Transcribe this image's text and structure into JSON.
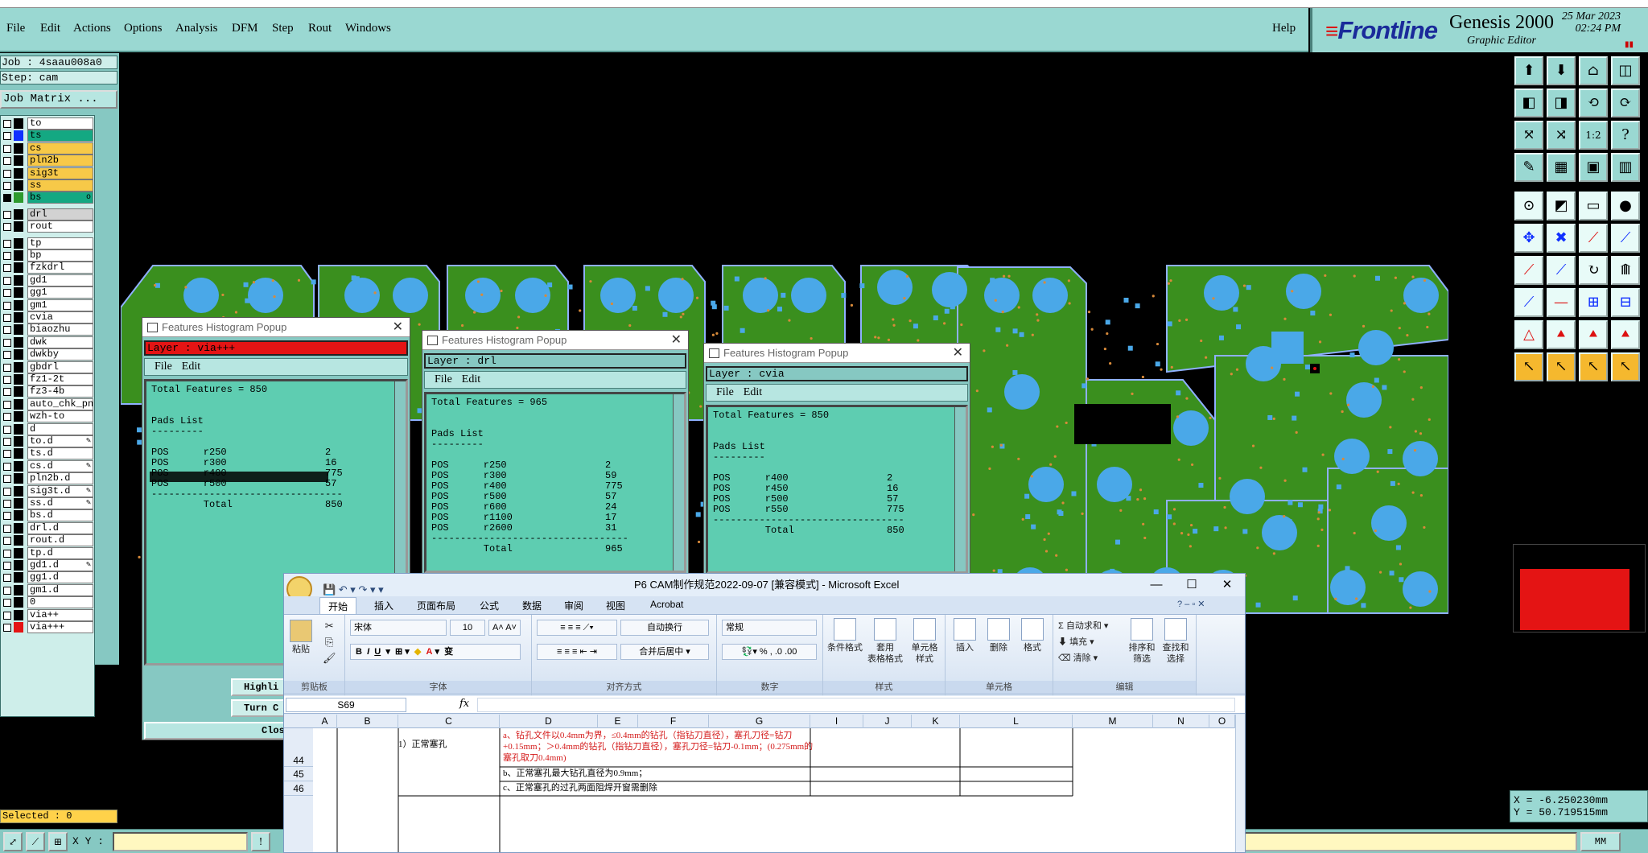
{
  "menu": {
    "items": [
      "File",
      "Edit",
      "Actions",
      "Options",
      "Analysis",
      "DFM",
      "Step",
      "Rout",
      "Windows"
    ],
    "help": "Help"
  },
  "brand": {
    "logo": "Frontline",
    "title": "Genesis 2000",
    "subtitle": "Graphic Editor",
    "date": "25 Mar 2023",
    "time": "02:24 PM"
  },
  "left": {
    "job": "Job : 4saau008a0",
    "step": "Step: cam",
    "job_matrix": "Job Matrix ...",
    "layers": [
      {
        "name": "to",
        "color": "#000000",
        "bg": "#ffffff",
        "checked": false
      },
      {
        "name": "ts",
        "color": "#1030ff",
        "bg": "#14a882",
        "checked": false
      },
      {
        "name": "cs",
        "color": "#000000",
        "bg": "#f7c948",
        "checked": false
      },
      {
        "name": "pln2b",
        "color": "#000000",
        "bg": "#f7c948",
        "checked": false
      },
      {
        "name": "sig3t",
        "color": "#000000",
        "bg": "#f7c948",
        "checked": false
      },
      {
        "name": "ss",
        "color": "#000000",
        "bg": "#f7c948",
        "checked": false
      },
      {
        "name": "bs",
        "color": "#2e9a2e",
        "bg": "#14a882",
        "checked": true,
        "mark": "o"
      },
      {
        "name": "drl",
        "color": "#000000",
        "bg": "#d2d2d2",
        "checked": false
      },
      {
        "name": "rout",
        "color": "#000000",
        "bg": "#ffffff",
        "checked": false
      },
      {
        "name": "tp",
        "color": "#000000",
        "bg": "#ffffff",
        "checked": false
      },
      {
        "name": "bp",
        "color": "#000000",
        "bg": "#ffffff",
        "checked": false
      },
      {
        "name": "fzkdrl",
        "color": "#000000",
        "bg": "#ffffff",
        "checked": false
      },
      {
        "name": "gd1",
        "color": "#000000",
        "bg": "#ffffff",
        "checked": false
      },
      {
        "name": "gg1",
        "color": "#000000",
        "bg": "#ffffff",
        "checked": false
      },
      {
        "name": "gm1",
        "color": "#000000",
        "bg": "#ffffff",
        "checked": false
      },
      {
        "name": "cvia",
        "color": "#000000",
        "bg": "#ffffff",
        "checked": false
      },
      {
        "name": "biaozhu",
        "color": "#000000",
        "bg": "#ffffff",
        "checked": false
      },
      {
        "name": "dwk",
        "color": "#000000",
        "bg": "#ffffff",
        "checked": false
      },
      {
        "name": "dwkby",
        "color": "#000000",
        "bg": "#ffffff",
        "checked": false
      },
      {
        "name": "gbdrl",
        "color": "#000000",
        "bg": "#ffffff",
        "checked": false
      },
      {
        "name": "fz1-2t",
        "color": "#000000",
        "bg": "#ffffff",
        "checked": false
      },
      {
        "name": "fz3-4b",
        "color": "#000000",
        "bg": "#ffffff",
        "checked": false
      },
      {
        "name": "auto_chk_pn",
        "color": "#000000",
        "bg": "#ffffff",
        "checked": false
      },
      {
        "name": "wzh-to",
        "color": "#000000",
        "bg": "#ffffff",
        "checked": false
      },
      {
        "name": "d",
        "color": "#000000",
        "bg": "#ffffff",
        "checked": false
      },
      {
        "name": "to.d",
        "color": "#000000",
        "bg": "#ffffff",
        "checked": false,
        "mark": "✎"
      },
      {
        "name": "ts.d",
        "color": "#000000",
        "bg": "#ffffff",
        "checked": false
      },
      {
        "name": "cs.d",
        "color": "#000000",
        "bg": "#ffffff",
        "checked": false,
        "mark": "✎"
      },
      {
        "name": "pln2b.d",
        "color": "#000000",
        "bg": "#ffffff",
        "checked": false
      },
      {
        "name": "sig3t.d",
        "color": "#000000",
        "bg": "#ffffff",
        "checked": false,
        "mark": "✎"
      },
      {
        "name": "ss.d",
        "color": "#000000",
        "bg": "#ffffff",
        "checked": false,
        "mark": "✎"
      },
      {
        "name": "bs.d",
        "color": "#000000",
        "bg": "#ffffff",
        "checked": false
      },
      {
        "name": "drl.d",
        "color": "#000000",
        "bg": "#ffffff",
        "checked": false
      },
      {
        "name": "rout.d",
        "color": "#000000",
        "bg": "#ffffff",
        "checked": false
      },
      {
        "name": "tp.d",
        "color": "#000000",
        "bg": "#ffffff",
        "checked": false
      },
      {
        "name": "gd1.d",
        "color": "#000000",
        "bg": "#ffffff",
        "checked": false,
        "mark": "✎"
      },
      {
        "name": "gg1.d",
        "color": "#000000",
        "bg": "#ffffff",
        "checked": false
      },
      {
        "name": "gm1.d",
        "color": "#000000",
        "bg": "#ffffff",
        "checked": false
      },
      {
        "name": "0",
        "color": "#000000",
        "bg": "#ffffff",
        "checked": false
      },
      {
        "name": "via++",
        "color": "#000000",
        "bg": "#ffffff",
        "checked": false
      },
      {
        "name": "via+++",
        "color": "#e41414",
        "bg": "#ffffff",
        "checked": false
      }
    ],
    "selected": "Selected : 0"
  },
  "bottom": {
    "xy_label": "X Y :",
    "unit": "MM"
  },
  "coords": {
    "x": "X = -6.250230mm",
    "y": "Y = 50.719515mm"
  },
  "popups": [
    {
      "title": "Features Histogram Popup",
      "layer": "Layer :  via+++",
      "layer_bg": "#e41414",
      "menu": [
        "File",
        "Edit"
      ],
      "text": "Total Features = 850\n\n\nPads List\n---------\n\nPOS      r250                 2\nPOS      r300                 16\nPOS      r400                 775\nPOS      r500                 57\n---------------------------------\n         Total                850",
      "highlight": "Highli",
      "turn": "Turn C",
      "close": "Clos"
    },
    {
      "title": "Features Histogram Popup",
      "layer": "Layer :  drl",
      "layer_bg": "#86c8c2",
      "menu": [
        "File",
        "Edit"
      ],
      "text": "Total Features = 965\n\n\nPads List\n---------\n\nPOS      r250                 2\nPOS      r300                 59\nPOS      r400                 775\nPOS      r500                 57\nPOS      r600                 24\nPOS      r1100                17\nPOS      r2600                31\n----------------------------------\n         Total                965"
    },
    {
      "title": "Features Histogram Popup",
      "layer": "Layer :  cvia",
      "layer_bg": "#86c8c2",
      "menu": [
        "File",
        "Edit"
      ],
      "text": "Total Features = 850\n\n\nPads List\n---------\n\nPOS      r400                 2\nPOS      r450                 16\nPOS      r500                 57\nPOS      r550                 775\n---------------------------------\n         Total                850"
    }
  ],
  "excel": {
    "title": "P6 CAM制作规范2022-09-07  [兼容模式] - Microsoft Excel",
    "tabs": [
      "开始",
      "插入",
      "页面布局",
      "公式",
      "数据",
      "审阅",
      "视图",
      "Acrobat"
    ],
    "groups": {
      "clipboard": "剪贴板",
      "font": "字体",
      "align": "对齐方式",
      "number": "数字",
      "style": "样式",
      "cells": "单元格",
      "edit": "编辑"
    },
    "paste": "粘贴",
    "font_name": "宋体",
    "font_size": "10",
    "wrap": "自动换行",
    "merge": "合并后居中",
    "number_format": "常规",
    "cond_format": "条件格式",
    "table_format": "套用\n表格格式",
    "cell_style": "单元格\n样式",
    "insert": "插入",
    "delete": "删除",
    "format": "格式",
    "autosum": "自动求和",
    "fill": "填充",
    "clear": "清除",
    "sort": "排序和\n筛选",
    "find": "查找和\n选择",
    "namebox": "S69",
    "columns": [
      "A",
      "B",
      "C",
      "D",
      "E",
      "F",
      "G",
      "I",
      "J",
      "K",
      "L",
      "M",
      "N",
      "O"
    ],
    "rows": [
      "44",
      "45",
      "46"
    ],
    "c44": "1）正常塞孔",
    "d44": "a、钻孔文件以0.4mm为界，≤0.4mm的钻孔（指钻刀直径），塞孔刀径=钻刀+0.15mm；＞0.4mm的钻孔（指钻刀直径），塞孔刀径=钻刀-0.1mm；(0.275mm的塞孔取刀0.4mm)",
    "d45": "b、正常塞孔最大钻孔直径为0.9mm；",
    "d46": "c、正常塞孔的过孔两面阻焊开窗需删除"
  }
}
